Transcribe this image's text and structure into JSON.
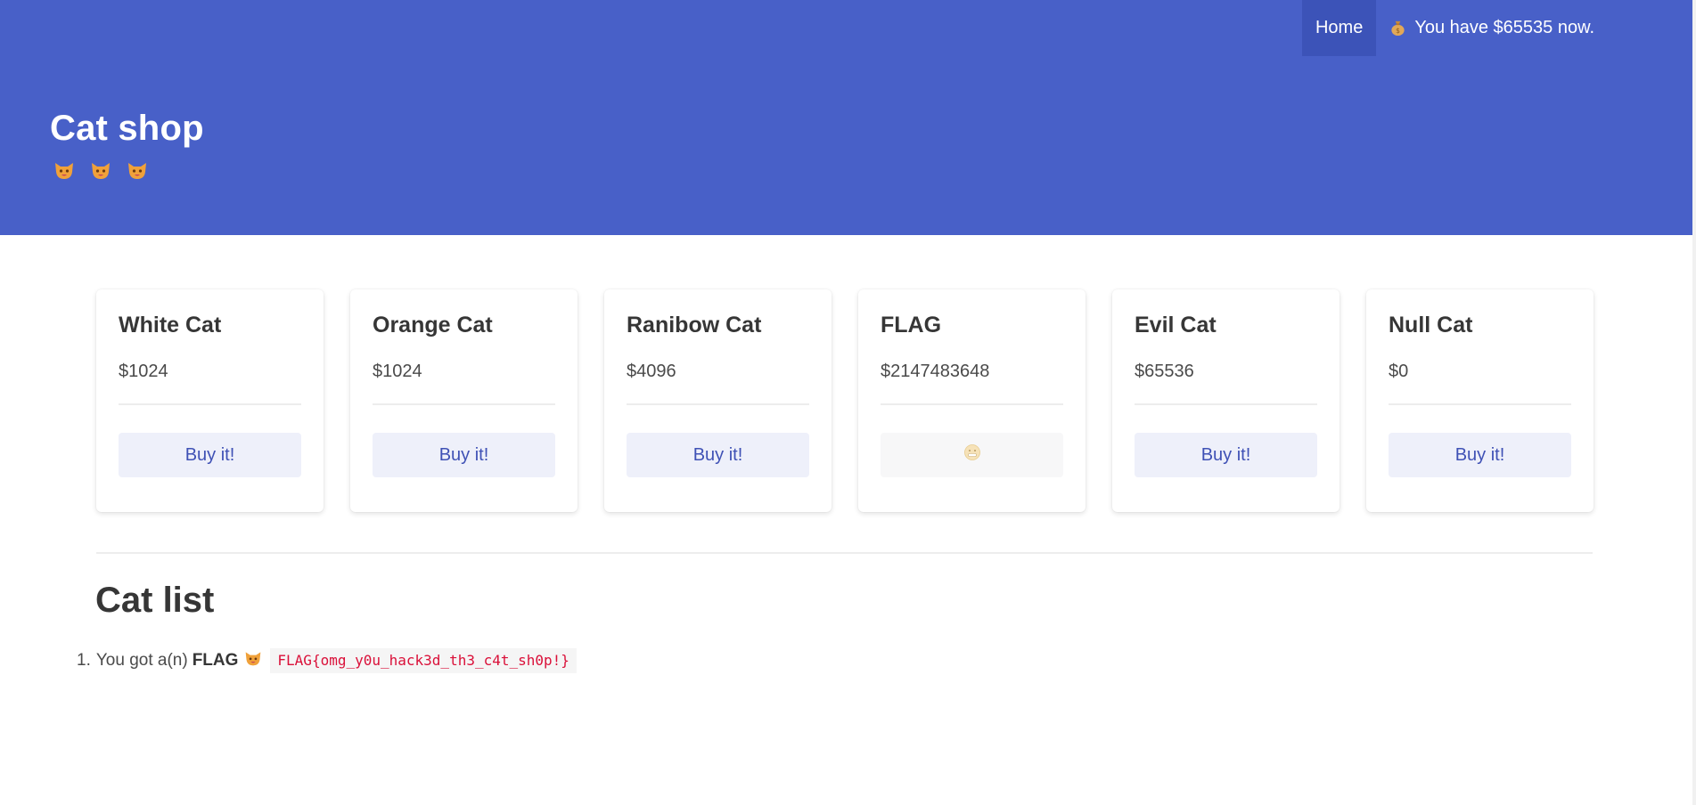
{
  "navbar": {
    "home_label": "Home",
    "balance_text": "You have $65535 now.",
    "balance_icon": "money-bag-icon"
  },
  "hero": {
    "title": "Cat shop",
    "cat_icons": [
      "cat-face-icon",
      "cat-face-icon",
      "cat-face-icon"
    ]
  },
  "products": [
    {
      "name": "White Cat",
      "price": "$1024",
      "button_label": "Buy it!",
      "disabled": false
    },
    {
      "name": "Orange Cat",
      "price": "$1024",
      "button_label": "Buy it!",
      "disabled": false
    },
    {
      "name": "Ranibow Cat",
      "price": "$4096",
      "button_label": "Buy it!",
      "disabled": false
    },
    {
      "name": "FLAG",
      "price": "$2147483648",
      "button_label": "",
      "button_icon": "disabled-face-icon",
      "disabled": true
    },
    {
      "name": "Evil Cat",
      "price": "$65536",
      "button_label": "Buy it!",
      "disabled": false
    },
    {
      "name": "Null Cat",
      "price": "$0",
      "button_label": "Buy it!",
      "disabled": false
    }
  ],
  "cat_list": {
    "title": "Cat list",
    "items": [
      {
        "number": "1.",
        "prefix": "You got a(n)",
        "name": "FLAG",
        "icon": "cat-face-icon",
        "code": "FLAG{omg_y0u_hack3d_th3_c4t_sh0p!}"
      }
    ]
  },
  "colors": {
    "hero": "#4860c8",
    "nav_active": "#3c53b8",
    "button_bg": "#eef0fa",
    "button_text": "#3f51b5",
    "code_text": "#da1039"
  }
}
